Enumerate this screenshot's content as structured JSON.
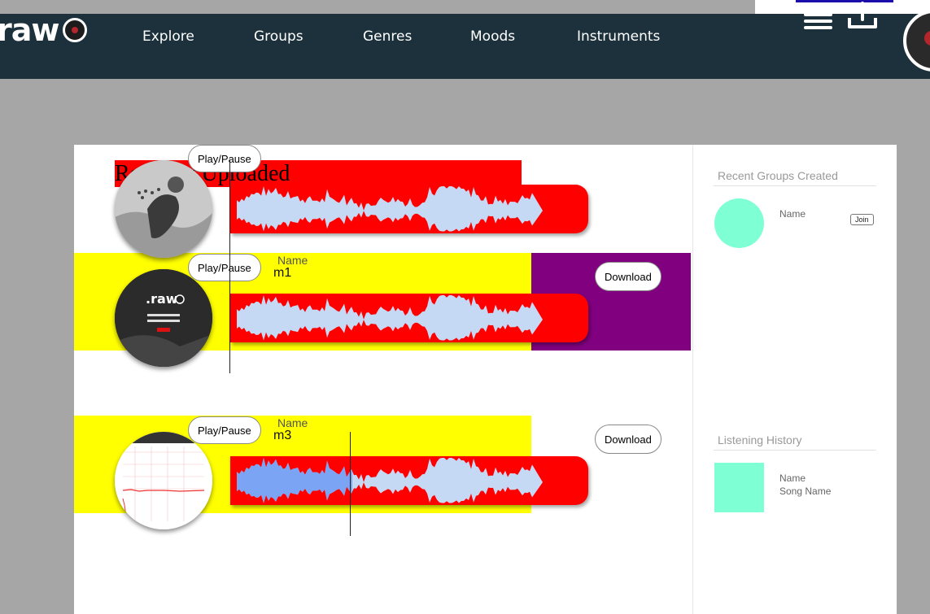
{
  "brand": {
    "logo_text": "raw"
  },
  "nav": {
    "items": [
      {
        "label": "Explore"
      },
      {
        "label": "Groups"
      },
      {
        "label": "Genres"
      },
      {
        "label": "Moods"
      },
      {
        "label": "Instruments"
      }
    ]
  },
  "main": {
    "heading": "Recently Uploaded",
    "tracks": [
      {
        "play_label": "Play/Pause",
        "name_label": "",
        "title": "",
        "download_label": ""
      },
      {
        "play_label": "Play/Pause",
        "name_label": "Name",
        "title": "m1",
        "download_label": "Download"
      },
      {
        "play_label": "Play/Pause",
        "name_label": "Name",
        "title": "m3",
        "download_label": "Download"
      }
    ]
  },
  "sidebar": {
    "groups_title": "Recent Groups Created",
    "group": {
      "name": "Name",
      "join_label": "Join"
    },
    "history_title": "Listening History",
    "history_item": {
      "name": "Name",
      "song": "Song Name"
    }
  },
  "colors": {
    "navbar": "#1c313c",
    "page_bg": "#a6a6a6",
    "track_bg": "#ffff00",
    "wave_bar": "#ff0000",
    "waveform": "#c5d9f5",
    "waveform_played": "#7ba4f5",
    "download_bg": "#800080",
    "avatar_placeholder": "#7fffd4"
  },
  "icons": [
    "menu-icon",
    "upload-icon",
    "record-disc-icon"
  ]
}
